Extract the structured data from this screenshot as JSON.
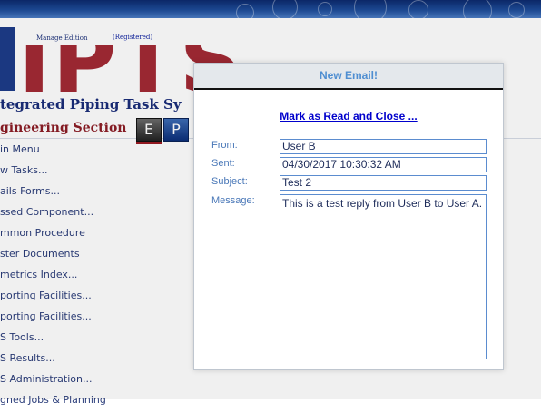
{
  "app": {
    "edition": "Manage Edition",
    "registered": "(Registered)",
    "logo": "IPTS",
    "subtitle": "tegrated Piping Task Sy",
    "section": "gineering Section",
    "tab_e": "E",
    "tab_p": "P",
    "colors": {
      "banner": "#1e4d9a",
      "brand_red": "#a32a35",
      "brand_blue": "#1a2d7a"
    }
  },
  "menu": {
    "items": [
      {
        "label": "in Menu"
      },
      {
        "label": "w Tasks..."
      },
      {
        "label": "ails Forms..."
      },
      {
        "label": "ssed Component..."
      },
      {
        "label": "mmon Procedure"
      },
      {
        "label": "ster Documents"
      },
      {
        "label": "metrics Index..."
      },
      {
        "label": "porting Facilities..."
      },
      {
        "label": "porting Facilities..."
      },
      {
        "label": "S Tools..."
      },
      {
        "label": "S Results..."
      },
      {
        "label": "S Administration..."
      },
      {
        "label": "gned Jobs & Planning"
      }
    ]
  },
  "modal": {
    "title": "New Email!",
    "mark_read_link": "Mark as Read and Close ...",
    "from_label": "From:",
    "from_value": "User B",
    "sent_label": "Sent:",
    "sent_value": "04/30/2017 10:30:32 AM",
    "subject_label": "Subject:",
    "subject_value": "Test 2",
    "message_label": "Message:",
    "message_value": "This is a test reply from User B to User A."
  }
}
